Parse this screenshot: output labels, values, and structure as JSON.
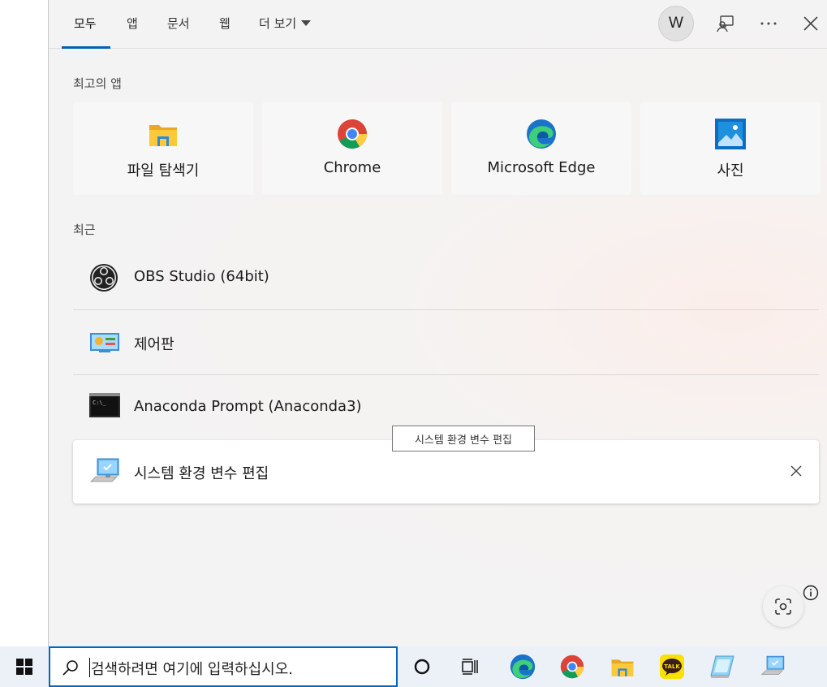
{
  "tabs": [
    {
      "label": "모두"
    },
    {
      "label": "앱"
    },
    {
      "label": "문서"
    },
    {
      "label": "웹"
    },
    {
      "label": "더 보기"
    }
  ],
  "avatar_letter": "W",
  "top_apps_label": "최고의 앱",
  "top_apps": [
    {
      "label": "파일 탐색기",
      "icon": "file-explorer-icon"
    },
    {
      "label": "Chrome",
      "icon": "chrome-icon"
    },
    {
      "label": "Microsoft Edge",
      "icon": "edge-icon"
    },
    {
      "label": "사진",
      "icon": "photos-icon"
    }
  ],
  "recent_label": "최근",
  "recent": [
    {
      "label": "OBS Studio (64bit)",
      "icon": "obs-icon"
    },
    {
      "label": "제어판",
      "icon": "control-panel-icon"
    },
    {
      "label": "Anaconda Prompt (Anaconda3)",
      "icon": "terminal-icon"
    },
    {
      "label": "시스템 환경 변수 편집",
      "icon": "system-properties-icon"
    }
  ],
  "tooltip": "시스템 환경 변수 편집",
  "taskbar": {
    "search_placeholder": "검색하려면 여기에 입력하십시오.",
    "kakao_badge": "TALK"
  },
  "colors": {
    "accent": "#0067c0",
    "tab_underline": "#0063b1",
    "taskbar_bg": "#ecf1f7"
  }
}
